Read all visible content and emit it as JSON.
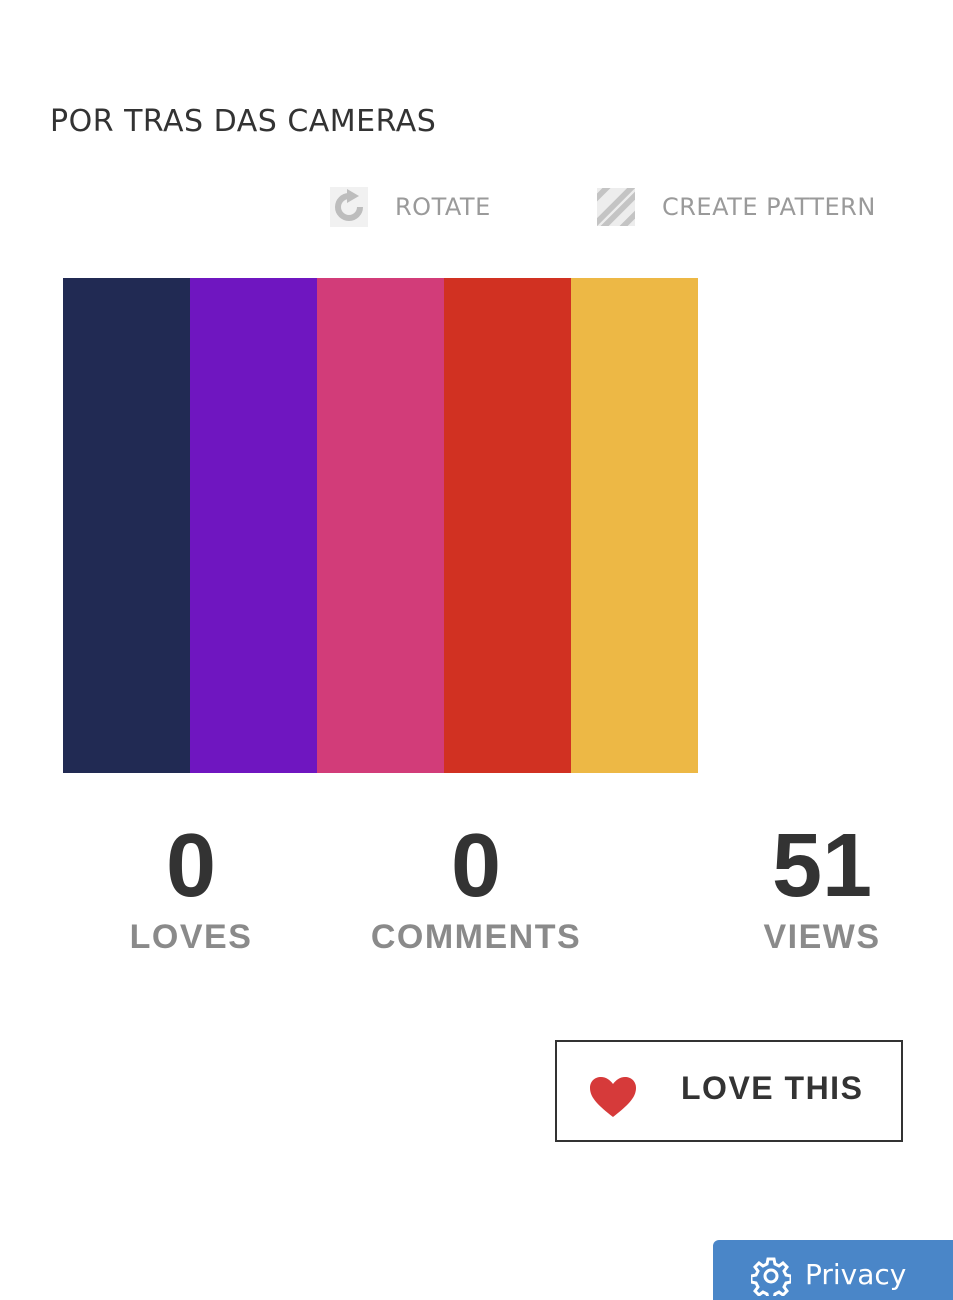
{
  "palette": {
    "title": "POR TRAS DAS CAMERAS",
    "colors": [
      "#212A53",
      "#6F16C0",
      "#D23C79",
      "#D13122",
      "#EDB845"
    ]
  },
  "toolbar": {
    "rotate_label": "ROTATE",
    "rotate_icon": "rotate-icon",
    "pattern_label": "CREATE PATTERN",
    "pattern_icon": "pattern-icon"
  },
  "stats": {
    "loves": {
      "value": "0",
      "label": "LOVES"
    },
    "comments": {
      "value": "0",
      "label": "COMMENTS"
    },
    "views": {
      "value": "51",
      "label": "VIEWS"
    }
  },
  "love_button": {
    "label": "LOVE THIS",
    "icon": "heart-icon",
    "icon_color": "#D63A3A"
  },
  "privacy_button": {
    "label": "Privacy",
    "icon": "gear-icon",
    "color": "#4A86C8"
  }
}
